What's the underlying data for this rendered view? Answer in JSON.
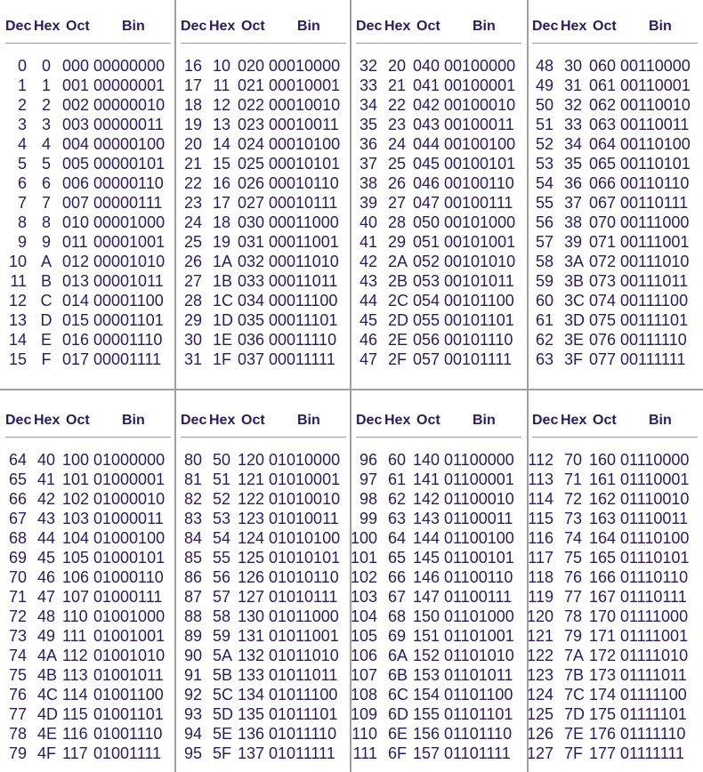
{
  "headers": {
    "dec": "Dec",
    "hex": "Hex",
    "oct": "Oct",
    "bin": "Bin"
  },
  "blocks": [
    {
      "rows": [
        [
          "0",
          "0",
          "000",
          "00000000"
        ],
        [
          "1",
          "1",
          "001",
          "00000001"
        ],
        [
          "2",
          "2",
          "002",
          "00000010"
        ],
        [
          "3",
          "3",
          "003",
          "00000011"
        ],
        [
          "4",
          "4",
          "004",
          "00000100"
        ],
        [
          "5",
          "5",
          "005",
          "00000101"
        ],
        [
          "6",
          "6",
          "006",
          "00000110"
        ],
        [
          "7",
          "7",
          "007",
          "00000111"
        ],
        [
          "8",
          "8",
          "010",
          "00001000"
        ],
        [
          "9",
          "9",
          "011",
          "00001001"
        ],
        [
          "10",
          "A",
          "012",
          "00001010"
        ],
        [
          "11",
          "B",
          "013",
          "00001011"
        ],
        [
          "12",
          "C",
          "014",
          "00001100"
        ],
        [
          "13",
          "D",
          "015",
          "00001101"
        ],
        [
          "14",
          "E",
          "016",
          "00001110"
        ],
        [
          "15",
          "F",
          "017",
          "00001111"
        ]
      ]
    },
    {
      "rows": [
        [
          "16",
          "10",
          "020",
          "00010000"
        ],
        [
          "17",
          "11",
          "021",
          "00010001"
        ],
        [
          "18",
          "12",
          "022",
          "00010010"
        ],
        [
          "19",
          "13",
          "023",
          "00010011"
        ],
        [
          "20",
          "14",
          "024",
          "00010100"
        ],
        [
          "21",
          "15",
          "025",
          "00010101"
        ],
        [
          "22",
          "16",
          "026",
          "00010110"
        ],
        [
          "23",
          "17",
          "027",
          "00010111"
        ],
        [
          "24",
          "18",
          "030",
          "00011000"
        ],
        [
          "25",
          "19",
          "031",
          "00011001"
        ],
        [
          "26",
          "1A",
          "032",
          "00011010"
        ],
        [
          "27",
          "1B",
          "033",
          "00011011"
        ],
        [
          "28",
          "1C",
          "034",
          "00011100"
        ],
        [
          "29",
          "1D",
          "035",
          "00011101"
        ],
        [
          "30",
          "1E",
          "036",
          "00011110"
        ],
        [
          "31",
          "1F",
          "037",
          "00011111"
        ]
      ]
    },
    {
      "rows": [
        [
          "32",
          "20",
          "040",
          "00100000"
        ],
        [
          "33",
          "21",
          "041",
          "00100001"
        ],
        [
          "34",
          "22",
          "042",
          "00100010"
        ],
        [
          "35",
          "23",
          "043",
          "00100011"
        ],
        [
          "36",
          "24",
          "044",
          "00100100"
        ],
        [
          "37",
          "25",
          "045",
          "00100101"
        ],
        [
          "38",
          "26",
          "046",
          "00100110"
        ],
        [
          "39",
          "27",
          "047",
          "00100111"
        ],
        [
          "40",
          "28",
          "050",
          "00101000"
        ],
        [
          "41",
          "29",
          "051",
          "00101001"
        ],
        [
          "42",
          "2A",
          "052",
          "00101010"
        ],
        [
          "43",
          "2B",
          "053",
          "00101011"
        ],
        [
          "44",
          "2C",
          "054",
          "00101100"
        ],
        [
          "45",
          "2D",
          "055",
          "00101101"
        ],
        [
          "46",
          "2E",
          "056",
          "00101110"
        ],
        [
          "47",
          "2F",
          "057",
          "00101111"
        ]
      ]
    },
    {
      "rows": [
        [
          "48",
          "30",
          "060",
          "00110000"
        ],
        [
          "49",
          "31",
          "061",
          "00110001"
        ],
        [
          "50",
          "32",
          "062",
          "00110010"
        ],
        [
          "51",
          "33",
          "063",
          "00110011"
        ],
        [
          "52",
          "34",
          "064",
          "00110100"
        ],
        [
          "53",
          "35",
          "065",
          "00110101"
        ],
        [
          "54",
          "36",
          "066",
          "00110110"
        ],
        [
          "55",
          "37",
          "067",
          "00110111"
        ],
        [
          "56",
          "38",
          "070",
          "00111000"
        ],
        [
          "57",
          "39",
          "071",
          "00111001"
        ],
        [
          "58",
          "3A",
          "072",
          "00111010"
        ],
        [
          "59",
          "3B",
          "073",
          "00111011"
        ],
        [
          "60",
          "3C",
          "074",
          "00111100"
        ],
        [
          "61",
          "3D",
          "075",
          "00111101"
        ],
        [
          "62",
          "3E",
          "076",
          "00111110"
        ],
        [
          "63",
          "3F",
          "077",
          "00111111"
        ]
      ]
    },
    {
      "rows": [
        [
          "64",
          "40",
          "100",
          "01000000"
        ],
        [
          "65",
          "41",
          "101",
          "01000001"
        ],
        [
          "66",
          "42",
          "102",
          "01000010"
        ],
        [
          "67",
          "43",
          "103",
          "01000011"
        ],
        [
          "68",
          "44",
          "104",
          "01000100"
        ],
        [
          "69",
          "45",
          "105",
          "01000101"
        ],
        [
          "70",
          "46",
          "106",
          "01000110"
        ],
        [
          "71",
          "47",
          "107",
          "01000111"
        ],
        [
          "72",
          "48",
          "110",
          "01001000"
        ],
        [
          "73",
          "49",
          "111",
          "01001001"
        ],
        [
          "74",
          "4A",
          "112",
          "01001010"
        ],
        [
          "75",
          "4B",
          "113",
          "01001011"
        ],
        [
          "76",
          "4C",
          "114",
          "01001100"
        ],
        [
          "77",
          "4D",
          "115",
          "01001101"
        ],
        [
          "78",
          "4E",
          "116",
          "01001110"
        ],
        [
          "79",
          "4F",
          "117",
          "01001111"
        ]
      ]
    },
    {
      "rows": [
        [
          "80",
          "50",
          "120",
          "01010000"
        ],
        [
          "81",
          "51",
          "121",
          "01010001"
        ],
        [
          "82",
          "52",
          "122",
          "01010010"
        ],
        [
          "83",
          "53",
          "123",
          "01010011"
        ],
        [
          "84",
          "54",
          "124",
          "01010100"
        ],
        [
          "85",
          "55",
          "125",
          "01010101"
        ],
        [
          "86",
          "56",
          "126",
          "01010110"
        ],
        [
          "87",
          "57",
          "127",
          "01010111"
        ],
        [
          "88",
          "58",
          "130",
          "01011000"
        ],
        [
          "89",
          "59",
          "131",
          "01011001"
        ],
        [
          "90",
          "5A",
          "132",
          "01011010"
        ],
        [
          "91",
          "5B",
          "133",
          "01011011"
        ],
        [
          "92",
          "5C",
          "134",
          "01011100"
        ],
        [
          "93",
          "5D",
          "135",
          "01011101"
        ],
        [
          "94",
          "5E",
          "136",
          "01011110"
        ],
        [
          "95",
          "5F",
          "137",
          "01011111"
        ]
      ]
    },
    {
      "rows": [
        [
          "96",
          "60",
          "140",
          "01100000"
        ],
        [
          "97",
          "61",
          "141",
          "01100001"
        ],
        [
          "98",
          "62",
          "142",
          "01100010"
        ],
        [
          "99",
          "63",
          "143",
          "01100011"
        ],
        [
          "100",
          "64",
          "144",
          "01100100"
        ],
        [
          "101",
          "65",
          "145",
          "01100101"
        ],
        [
          "102",
          "66",
          "146",
          "01100110"
        ],
        [
          "103",
          "67",
          "147",
          "01100111"
        ],
        [
          "104",
          "68",
          "150",
          "01101000"
        ],
        [
          "105",
          "69",
          "151",
          "01101001"
        ],
        [
          "106",
          "6A",
          "152",
          "01101010"
        ],
        [
          "107",
          "6B",
          "153",
          "01101011"
        ],
        [
          "108",
          "6C",
          "154",
          "01101100"
        ],
        [
          "109",
          "6D",
          "155",
          "01101101"
        ],
        [
          "110",
          "6E",
          "156",
          "01101110"
        ],
        [
          "111",
          "6F",
          "157",
          "01101111"
        ]
      ]
    },
    {
      "rows": [
        [
          "112",
          "70",
          "160",
          "01110000"
        ],
        [
          "113",
          "71",
          "161",
          "01110001"
        ],
        [
          "114",
          "72",
          "162",
          "01110010"
        ],
        [
          "115",
          "73",
          "163",
          "01110011"
        ],
        [
          "116",
          "74",
          "164",
          "01110100"
        ],
        [
          "117",
          "75",
          "165",
          "01110101"
        ],
        [
          "118",
          "76",
          "166",
          "01110110"
        ],
        [
          "119",
          "77",
          "167",
          "01110111"
        ],
        [
          "120",
          "78",
          "170",
          "01111000"
        ],
        [
          "121",
          "79",
          "171",
          "01111001"
        ],
        [
          "122",
          "7A",
          "172",
          "01111010"
        ],
        [
          "123",
          "7B",
          "173",
          "01111011"
        ],
        [
          "124",
          "7C",
          "174",
          "01111100"
        ],
        [
          "125",
          "7D",
          "175",
          "01111101"
        ],
        [
          "126",
          "7E",
          "176",
          "01111110"
        ],
        [
          "127",
          "7F",
          "177",
          "01111111"
        ]
      ]
    }
  ]
}
